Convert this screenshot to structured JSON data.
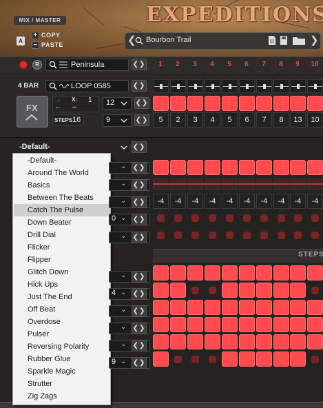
{
  "header": {
    "mix_master": "MIX / MASTER",
    "slot_badge": "A",
    "copy_label": "COPY",
    "paste_label": "PASTE",
    "title": "EXPEDITIONS",
    "preset_name": "Bourbon Trail",
    "colors": {
      "title": "#e9a57b",
      "leather": "#8a6238"
    }
  },
  "pattern_row": {
    "instrument": "Peninsula",
    "step_numbers": [
      "1",
      "2",
      "3",
      "4",
      "5",
      "6",
      "7",
      "8",
      "9",
      "10"
    ],
    "step_color": "#ec4a4a"
  },
  "loop_section": {
    "bar_label": "4 BAR",
    "loop_name": "LOOP 0585",
    "fx_label": "FX",
    "multiplier_label": "X:",
    "multiplier_value": "1",
    "steps_label": "STEPS",
    "steps_value": "16",
    "rate_value": "12",
    "second_value": "9",
    "slice_numbers": [
      "5",
      "2",
      "3",
      "4",
      "5",
      "6",
      "7",
      "8",
      "13",
      "10"
    ]
  },
  "preset_dropdown": {
    "selected": "-Default-"
  },
  "pitch_values": [
    "-4",
    "-4",
    "-4",
    "-4",
    "-4",
    "-4",
    "-4",
    "-4",
    "-4",
    "-4"
  ],
  "partial_row_values": {
    "row_a": "0",
    "row_b": "4",
    "row_c": "9"
  },
  "steps_header": "STEPS",
  "menu": {
    "items": [
      "-Default-",
      "Around The World",
      "Basics",
      "Between The Beats",
      "Catch The Pulse",
      "Down Beater",
      "Drill Dial",
      "Flicker",
      "Flipper",
      "Glitch Down",
      "Hick Ups",
      "Just The End",
      "Off Beat",
      "Overdose",
      "Pulser",
      "Reversing Polarity",
      "Rubber Glue",
      "Sparkle Magic",
      "Strutter",
      "Zig Zags"
    ],
    "hovered_index": 4
  },
  "grid_pattern": {
    "row1": [
      1,
      1,
      1,
      1,
      1,
      1,
      1,
      1,
      1,
      1
    ],
    "row2": [
      1,
      1,
      0,
      0,
      1,
      1,
      1,
      1,
      1,
      0
    ],
    "row3": [
      1,
      1,
      1,
      1,
      1,
      1,
      1,
      1,
      1,
      1
    ],
    "row4": [
      1,
      1,
      1,
      1,
      1,
      1,
      1,
      1,
      1,
      1
    ],
    "row5": [
      1,
      1,
      1,
      1,
      1,
      1,
      1,
      1,
      1,
      1
    ],
    "row6": [
      1,
      0,
      0,
      0,
      1,
      1,
      1,
      1,
      1,
      0
    ]
  }
}
